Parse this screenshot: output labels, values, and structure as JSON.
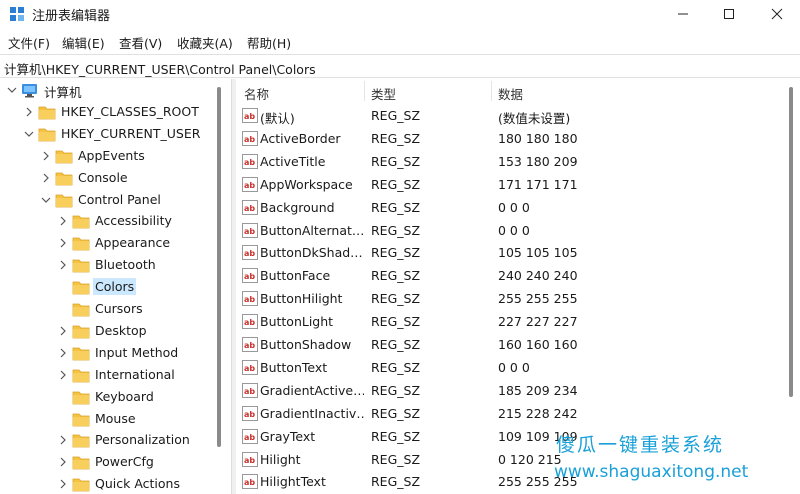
{
  "window": {
    "title": "注册表编辑器",
    "controls": {
      "minimize": "—",
      "maximize": "☐",
      "close": "✕"
    }
  },
  "menu": [
    "文件(F)",
    "编辑(E)",
    "查看(V)",
    "收藏夹(A)",
    "帮助(H)"
  ],
  "address": "计算机\\HKEY_CURRENT_USER\\Control Panel\\Colors",
  "tree": [
    {
      "label": "计算机",
      "name": "tree-node-computer",
      "state": "expanded",
      "icon": "computer-icon"
    },
    {
      "label": "HKEY_CLASSES_ROOT",
      "name": "tree-node-hkey-classes-root",
      "state": "collapsed",
      "icon": "folder-icon"
    },
    {
      "label": "HKEY_CURRENT_USER",
      "name": "tree-node-hkey-current-user",
      "state": "expanded",
      "icon": "folder-icon"
    },
    {
      "label": "AppEvents",
      "name": "tree-node-appevents",
      "state": "collapsed",
      "icon": "folder-icon"
    },
    {
      "label": "Console",
      "name": "tree-node-console",
      "state": "collapsed",
      "icon": "folder-icon"
    },
    {
      "label": "Control Panel",
      "name": "tree-node-control-panel",
      "state": "expanded",
      "icon": "folder-icon"
    },
    {
      "label": "Accessibility",
      "name": "tree-node-accessibility",
      "state": "collapsed",
      "icon": "folder-icon"
    },
    {
      "label": "Appearance",
      "name": "tree-node-appearance",
      "state": "collapsed",
      "icon": "folder-icon"
    },
    {
      "label": "Bluetooth",
      "name": "tree-node-bluetooth",
      "state": "collapsed",
      "icon": "folder-icon"
    },
    {
      "label": "Colors",
      "name": "tree-node-colors",
      "state": "selected",
      "icon": "folder-icon"
    },
    {
      "label": "Cursors",
      "name": "tree-node-cursors",
      "state": "leaf",
      "icon": "folder-icon"
    },
    {
      "label": "Desktop",
      "name": "tree-node-desktop",
      "state": "collapsed",
      "icon": "folder-icon"
    },
    {
      "label": "Input Method",
      "name": "tree-node-input-method",
      "state": "collapsed",
      "icon": "folder-icon"
    },
    {
      "label": "International",
      "name": "tree-node-international",
      "state": "collapsed",
      "icon": "folder-icon"
    },
    {
      "label": "Keyboard",
      "name": "tree-node-keyboard",
      "state": "leaf",
      "icon": "folder-icon"
    },
    {
      "label": "Mouse",
      "name": "tree-node-mouse",
      "state": "leaf",
      "icon": "folder-icon"
    },
    {
      "label": "Personalization",
      "name": "tree-node-personalization",
      "state": "collapsed",
      "icon": "folder-icon"
    },
    {
      "label": "PowerCfg",
      "name": "tree-node-powercfg",
      "state": "collapsed",
      "icon": "folder-icon"
    },
    {
      "label": "Quick Actions",
      "name": "tree-node-quick-actions",
      "state": "collapsed",
      "icon": "folder-icon"
    }
  ],
  "columns": {
    "name": "名称",
    "type": "类型",
    "data": "数据"
  },
  "rows": [
    {
      "name": "(默认)",
      "type": "REG_SZ",
      "data": "(数值未设置)"
    },
    {
      "name": "ActiveBorder",
      "type": "REG_SZ",
      "data": "180 180 180"
    },
    {
      "name": "ActiveTitle",
      "type": "REG_SZ",
      "data": "153 180 209"
    },
    {
      "name": "AppWorkspace",
      "type": "REG_SZ",
      "data": "171 171 171"
    },
    {
      "name": "Background",
      "type": "REG_SZ",
      "data": "0 0 0"
    },
    {
      "name": "ButtonAlternat…",
      "type": "REG_SZ",
      "data": "0 0 0"
    },
    {
      "name": "ButtonDkShad…",
      "type": "REG_SZ",
      "data": "105 105 105"
    },
    {
      "name": "ButtonFace",
      "type": "REG_SZ",
      "data": "240 240 240"
    },
    {
      "name": "ButtonHilight",
      "type": "REG_SZ",
      "data": "255 255 255"
    },
    {
      "name": "ButtonLight",
      "type": "REG_SZ",
      "data": "227 227 227"
    },
    {
      "name": "ButtonShadow",
      "type": "REG_SZ",
      "data": "160 160 160"
    },
    {
      "name": "ButtonText",
      "type": "REG_SZ",
      "data": "0 0 0"
    },
    {
      "name": "GradientActive…",
      "type": "REG_SZ",
      "data": "185 209 234"
    },
    {
      "name": "GradientInactiv…",
      "type": "REG_SZ",
      "data": "215 228 242"
    },
    {
      "name": "GrayText",
      "type": "REG_SZ",
      "data": "109 109 109"
    },
    {
      "name": "Hilight",
      "type": "REG_SZ",
      "data": "0 120 215"
    },
    {
      "name": "HilightText",
      "type": "REG_SZ",
      "data": "255 255 255"
    }
  ],
  "watermark": {
    "title": "傻瓜一键重装系统",
    "url": "www.shaguaxitong.net"
  },
  "colors": {
    "selection": "#cce8ff",
    "folder": "#f5c242",
    "watermark": "#1aa0d8",
    "value_icon": "#c8322d"
  }
}
